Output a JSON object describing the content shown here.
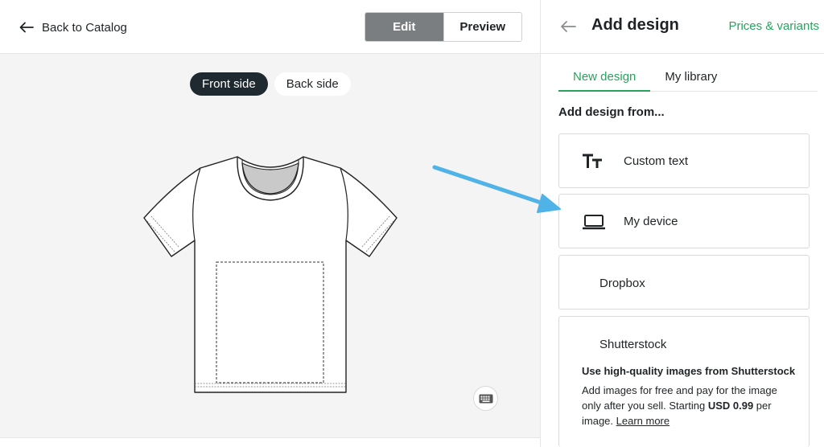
{
  "topbar": {
    "back_label": "Back to Catalog",
    "modes": [
      {
        "label": "Edit",
        "active": true
      },
      {
        "label": "Preview",
        "active": false
      }
    ]
  },
  "canvas": {
    "sides": [
      {
        "label": "Front side",
        "active": true
      },
      {
        "label": "Back side",
        "active": false
      }
    ],
    "keyboard_icon": "keyboard-icon"
  },
  "panel": {
    "title": "Add design",
    "link": "Prices & variants",
    "tabs": [
      {
        "label": "New design",
        "active": true
      },
      {
        "label": "My library",
        "active": false
      }
    ],
    "section_label": "Add design from...",
    "options": [
      {
        "label": "Custom text",
        "icon": "text-icon"
      },
      {
        "label": "My device",
        "icon": "laptop-icon"
      },
      {
        "label": "Dropbox"
      },
      {
        "label": "Shutterstock"
      }
    ],
    "shutterstock": {
      "title": "Use high-quality images from Shutterstock",
      "desc_before": "Add images for free and pay for the image only after you sell. Starting ",
      "price": "USD 0.99",
      "desc_after": " per image. ",
      "learn_more": "Learn more"
    }
  },
  "colors": {
    "accent_green": "#29a25e",
    "active_mode": "#7b7e81",
    "active_side": "#1f2a30",
    "annotation_arrow": "#4fb3e8"
  }
}
